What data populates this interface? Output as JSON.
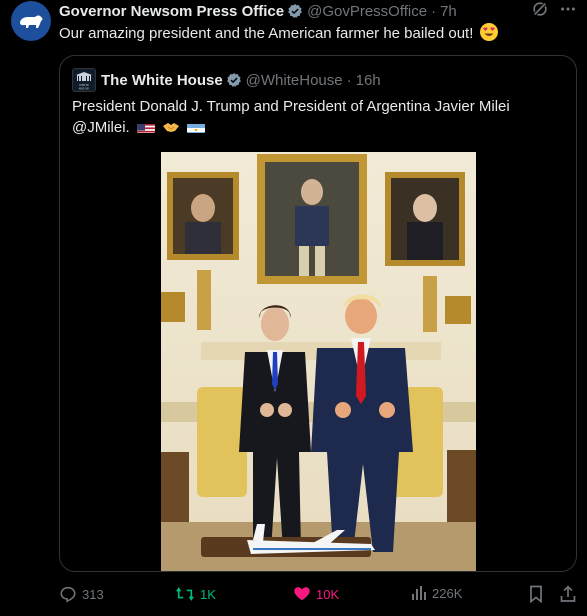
{
  "tweet": {
    "author_name": "Governor Newsom Press Office",
    "author_handle": "@GovPressOffice",
    "separator": "·",
    "time": "7h",
    "text": "Our amazing president and the American farmer he bailed out!",
    "emoji": "heart-eyes-emoji"
  },
  "quote": {
    "author_name": "The White House",
    "author_handle": "@WhiteHouse",
    "separator": "·",
    "time": "16h",
    "text": "President Donald J. Trump and President of Argentina Javier Milei @JMilei.",
    "emojis": [
      "us-flag",
      "handshake",
      "argentina-flag"
    ],
    "logo_text": "WHITE HOUSE"
  },
  "stats": {
    "replies": "313",
    "reposts": "1K",
    "likes": "10K",
    "views": "226K"
  },
  "colors": {
    "background": "#000000",
    "text": "#e7e9ea",
    "muted": "#71767b",
    "verified": "#829aab",
    "repost_green": "#00ba7c",
    "like_pink": "#f91880",
    "border": "#2f3336"
  }
}
